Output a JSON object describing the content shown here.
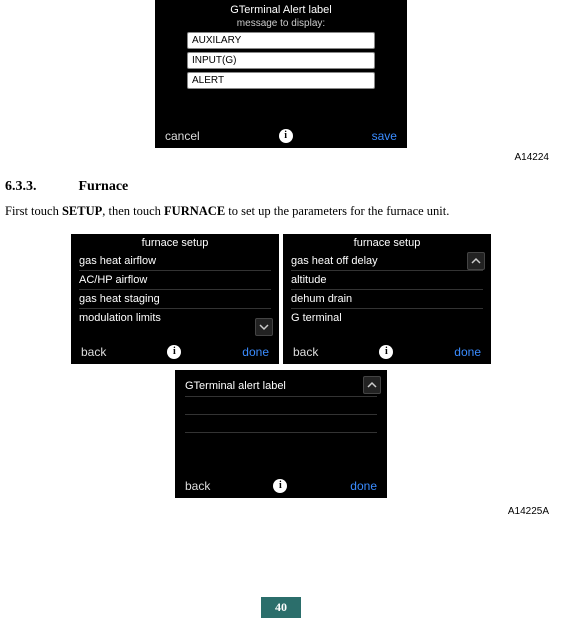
{
  "top_screen": {
    "title": "GTerminal Alert label",
    "subtitle": "message to display:",
    "fields": [
      "AUXILARY",
      "INPUT(G)",
      "ALERT"
    ],
    "cancel": "cancel",
    "save": "save",
    "info": "i"
  },
  "fig1": "A14224",
  "section": {
    "num": "6.3.3.",
    "title": "Furnace"
  },
  "body": {
    "p1a": "First touch ",
    "setup": "SETUP",
    "p1b": ", then touch ",
    "furnace": "FURNACE",
    "p1c": " to set up the parameters for the furnace unit."
  },
  "left": {
    "title": "furnace setup",
    "items": [
      "gas heat airflow",
      "AC/HP airflow",
      "gas heat staging",
      "modulation limits"
    ],
    "back": "back",
    "done": "done",
    "info": "i"
  },
  "right": {
    "title": "furnace setup",
    "items": [
      "gas heat off delay",
      "altitude",
      "dehum drain",
      "G terminal"
    ],
    "back": "back",
    "done": "done",
    "info": "i"
  },
  "bottom": {
    "item": "GTerminal alert label",
    "back": "back",
    "done": "done",
    "info": "i"
  },
  "fig2": "A14225A",
  "page": "40"
}
